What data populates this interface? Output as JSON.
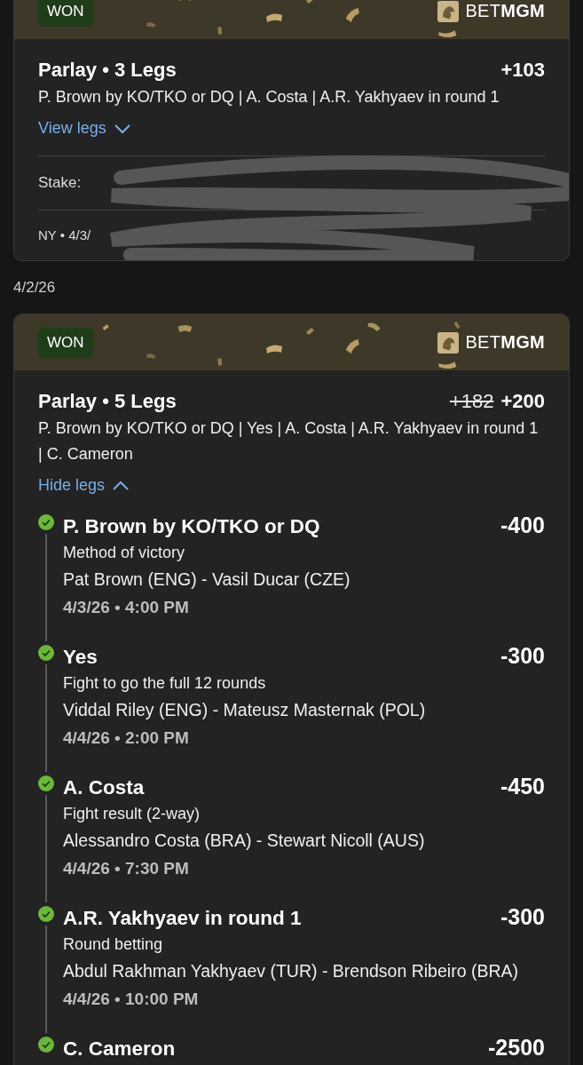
{
  "bets": [
    {
      "status": "WON",
      "brand": "BET**MGM**",
      "title": "Parlay • 3 Legs",
      "odds": "+103",
      "summary": "P. Brown by KO/TKO or DQ | A. Costa | A.R. Yakhyaev in round 1",
      "toggle": {
        "label": "View legs",
        "expanded": false
      },
      "stake_label": "Stake:",
      "footer": "NY • 4/3/",
      "redacted": true
    },
    {
      "date": "4/2/26",
      "status": "WON",
      "brand": "BET**MGM**",
      "title": "Parlay • 5 Legs",
      "old_odds": "+182",
      "odds": "+200",
      "summary": "P. Brown by KO/TKO or DQ | Yes | A. Costa | A.R. Yakhyaev in round 1 | C. Cameron",
      "toggle": {
        "label": "Hide legs",
        "expanded": true
      },
      "legs": [
        {
          "won": true,
          "pick": "P. Brown by KO/TKO or DQ",
          "odds": "-400",
          "market": "Method of victory",
          "matchup": "Pat Brown (ENG) - Vasil Ducar (CZE)",
          "time": "4/3/26 • 4:00 PM"
        },
        {
          "won": true,
          "pick": "Yes",
          "odds": "-300",
          "market": "Fight to go the full 12 rounds",
          "matchup": "Viddal Riley (ENG) - Mateusz Masternak (POL)",
          "time": "4/4/26 • 2:00 PM"
        },
        {
          "won": true,
          "pick": "A. Costa",
          "odds": "-450",
          "market": "Fight result (2-way)",
          "matchup": "Alessandro Costa (BRA) - Stewart Nicoll (AUS)",
          "time": "4/4/26 • 7:30 PM"
        },
        {
          "won": true,
          "pick": "A.R. Yakhyaev in round 1",
          "odds": "-300",
          "market": "Round betting",
          "matchup": "Abdul Rakhman Yakhyaev (TUR) - Brendson Ribeiro (BRA)",
          "time": "4/4/26 • 10:00 PM"
        },
        {
          "won": true,
          "pick": "C. Cameron",
          "odds": "-2500"
        }
      ]
    }
  ]
}
